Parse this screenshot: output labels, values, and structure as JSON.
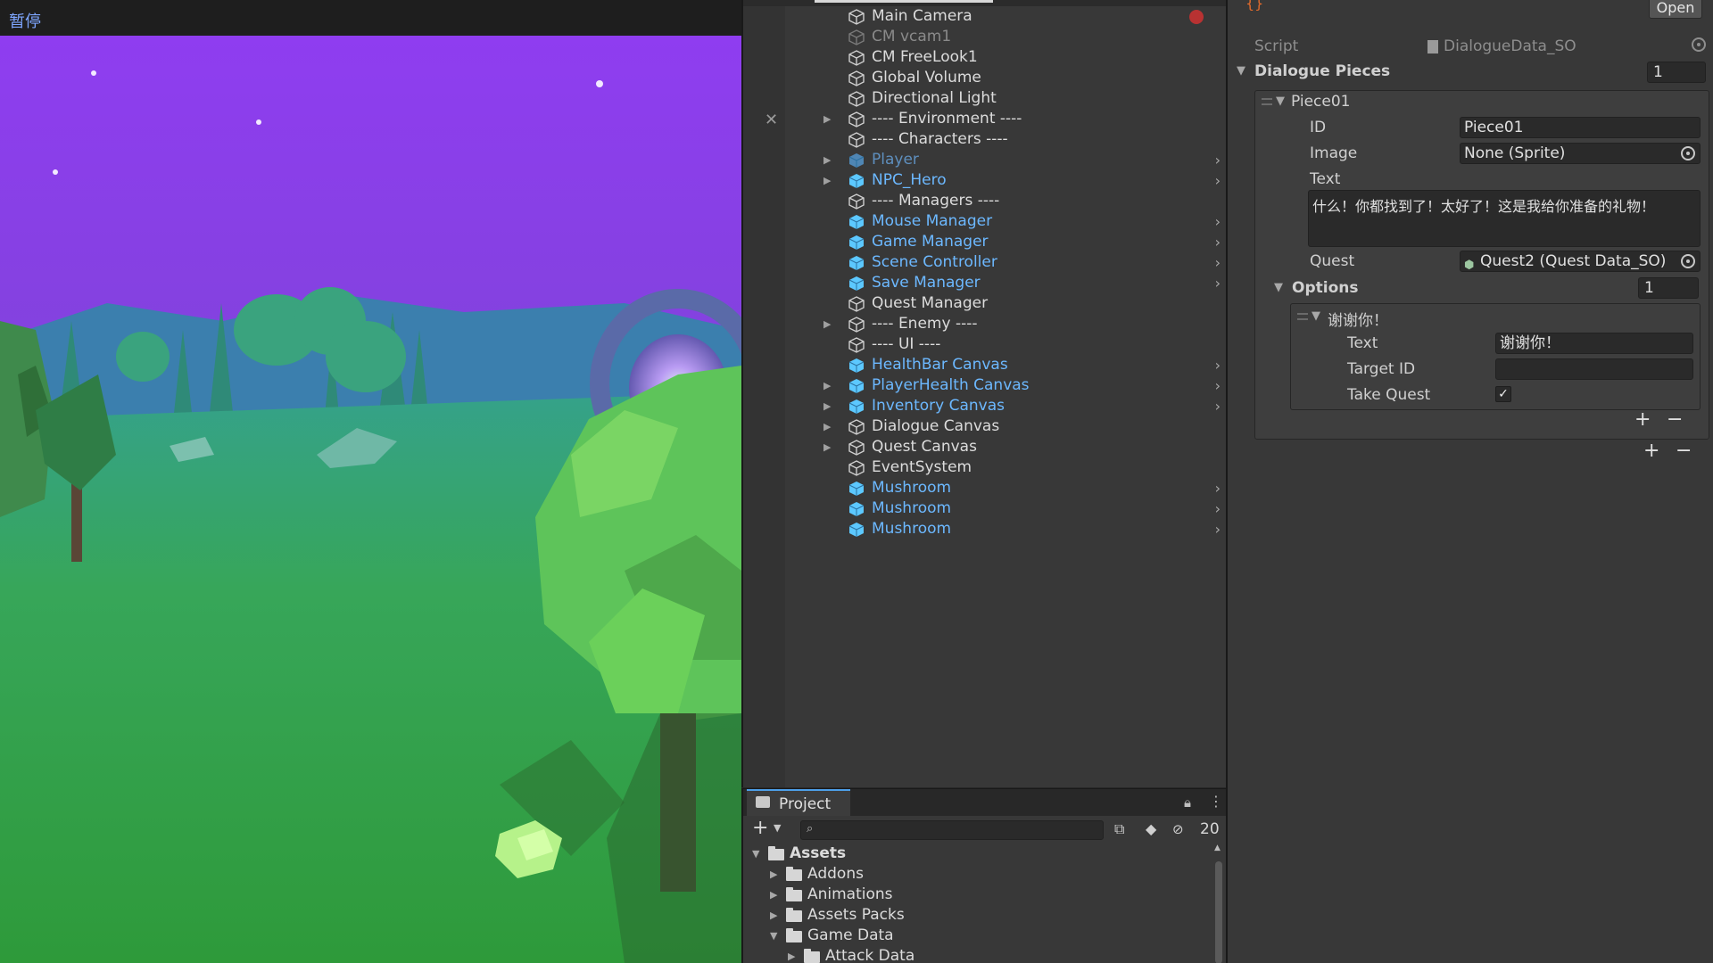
{
  "game_view": {
    "pause_label": "暂停"
  },
  "hierarchy": {
    "items": [
      {
        "label": "Main Camera",
        "style": "normal",
        "foldout": false,
        "chevron": false
      },
      {
        "label": "CM vcam1",
        "style": "dim",
        "foldout": false,
        "chevron": false
      },
      {
        "label": "CM FreeLook1",
        "style": "normal",
        "foldout": false,
        "chevron": false
      },
      {
        "label": "Global Volume",
        "style": "normal",
        "foldout": false,
        "chevron": false
      },
      {
        "label": "Directional Light",
        "style": "normal",
        "foldout": false,
        "chevron": false
      },
      {
        "label": "---- Environment ----",
        "style": "normal",
        "foldout": true,
        "chevron": false
      },
      {
        "label": "---- Characters ----",
        "style": "normal",
        "foldout": false,
        "chevron": false
      },
      {
        "label": "Player",
        "style": "dimprefab",
        "foldout": true,
        "chevron": true
      },
      {
        "label": "NPC_Hero",
        "style": "prefab",
        "foldout": true,
        "chevron": true
      },
      {
        "label": "---- Managers ----",
        "style": "normal",
        "foldout": false,
        "chevron": false
      },
      {
        "label": "Mouse Manager",
        "style": "prefab",
        "foldout": false,
        "chevron": true
      },
      {
        "label": "Game Manager",
        "style": "prefab",
        "foldout": false,
        "chevron": true
      },
      {
        "label": "Scene Controller",
        "style": "prefab",
        "foldout": false,
        "chevron": true
      },
      {
        "label": "Save Manager",
        "style": "prefab",
        "foldout": false,
        "chevron": true
      },
      {
        "label": "Quest Manager",
        "style": "normal",
        "foldout": false,
        "chevron": false
      },
      {
        "label": "---- Enemy ----",
        "style": "normal",
        "foldout": true,
        "chevron": false
      },
      {
        "label": "---- UI ----",
        "style": "normal",
        "foldout": false,
        "chevron": false
      },
      {
        "label": "HealthBar Canvas",
        "style": "prefab",
        "foldout": false,
        "chevron": true
      },
      {
        "label": "PlayerHealth Canvas",
        "style": "prefab",
        "foldout": true,
        "chevron": true
      },
      {
        "label": "Inventory Canvas",
        "style": "prefab",
        "foldout": true,
        "chevron": true
      },
      {
        "label": "Dialogue Canvas",
        "style": "normal",
        "foldout": true,
        "chevron": false
      },
      {
        "label": "Quest Canvas",
        "style": "normal",
        "foldout": true,
        "chevron": false
      },
      {
        "label": "EventSystem",
        "style": "normal",
        "foldout": false,
        "chevron": false
      },
      {
        "label": "Mushroom",
        "style": "prefab",
        "foldout": false,
        "chevron": true
      },
      {
        "label": "Mushroom",
        "style": "prefab",
        "foldout": false,
        "chevron": true
      },
      {
        "label": "Mushroom",
        "style": "prefab",
        "foldout": false,
        "chevron": true
      }
    ]
  },
  "project": {
    "tab_label": "Project",
    "hidden_count": "20",
    "tree": [
      {
        "label": "Assets",
        "depth": 0,
        "expanded": true,
        "bold": true
      },
      {
        "label": "Addons",
        "depth": 1,
        "expanded": false,
        "bold": false
      },
      {
        "label": "Animations",
        "depth": 1,
        "expanded": false,
        "bold": false
      },
      {
        "label": "Assets Packs",
        "depth": 1,
        "expanded": false,
        "bold": false
      },
      {
        "label": "Game Data",
        "depth": 1,
        "expanded": true,
        "bold": false
      },
      {
        "label": "Attack Data",
        "depth": 2,
        "expanded": false,
        "bold": false
      }
    ]
  },
  "inspector": {
    "open_label": "Open",
    "script_label": "Script",
    "script_value": "DialogueData_SO",
    "dialogue_pieces_label": "Dialogue Pieces",
    "dialogue_pieces_size": "1",
    "piece": {
      "name": "Piece01",
      "id_label": "ID",
      "id_value": "Piece01",
      "image_label": "Image",
      "image_value": "None (Sprite)",
      "text_label": "Text",
      "text_value": "什么！你都找到了！太好了！这是我给你准备的礼物！",
      "quest_label": "Quest",
      "quest_value": "Quest2 (Quest Data_SO)",
      "options_label": "Options",
      "options_size": "1",
      "option": {
        "name": "谢谢你！",
        "text_label": "Text",
        "text_value": "谢谢你！",
        "target_id_label": "Target ID",
        "target_id_value": "",
        "take_quest_label": "Take Quest",
        "take_quest_checked": true
      }
    },
    "add_symbol": "+",
    "remove_symbol": "−"
  },
  "colors": {
    "prefab_text": "#6cb8ff",
    "normal_text": "#dcdcdc",
    "panel_bg": "#383838",
    "field_bg": "#2a2a2a",
    "sky_purple": "#8a3ce6",
    "grass_green": "#3aa844"
  }
}
